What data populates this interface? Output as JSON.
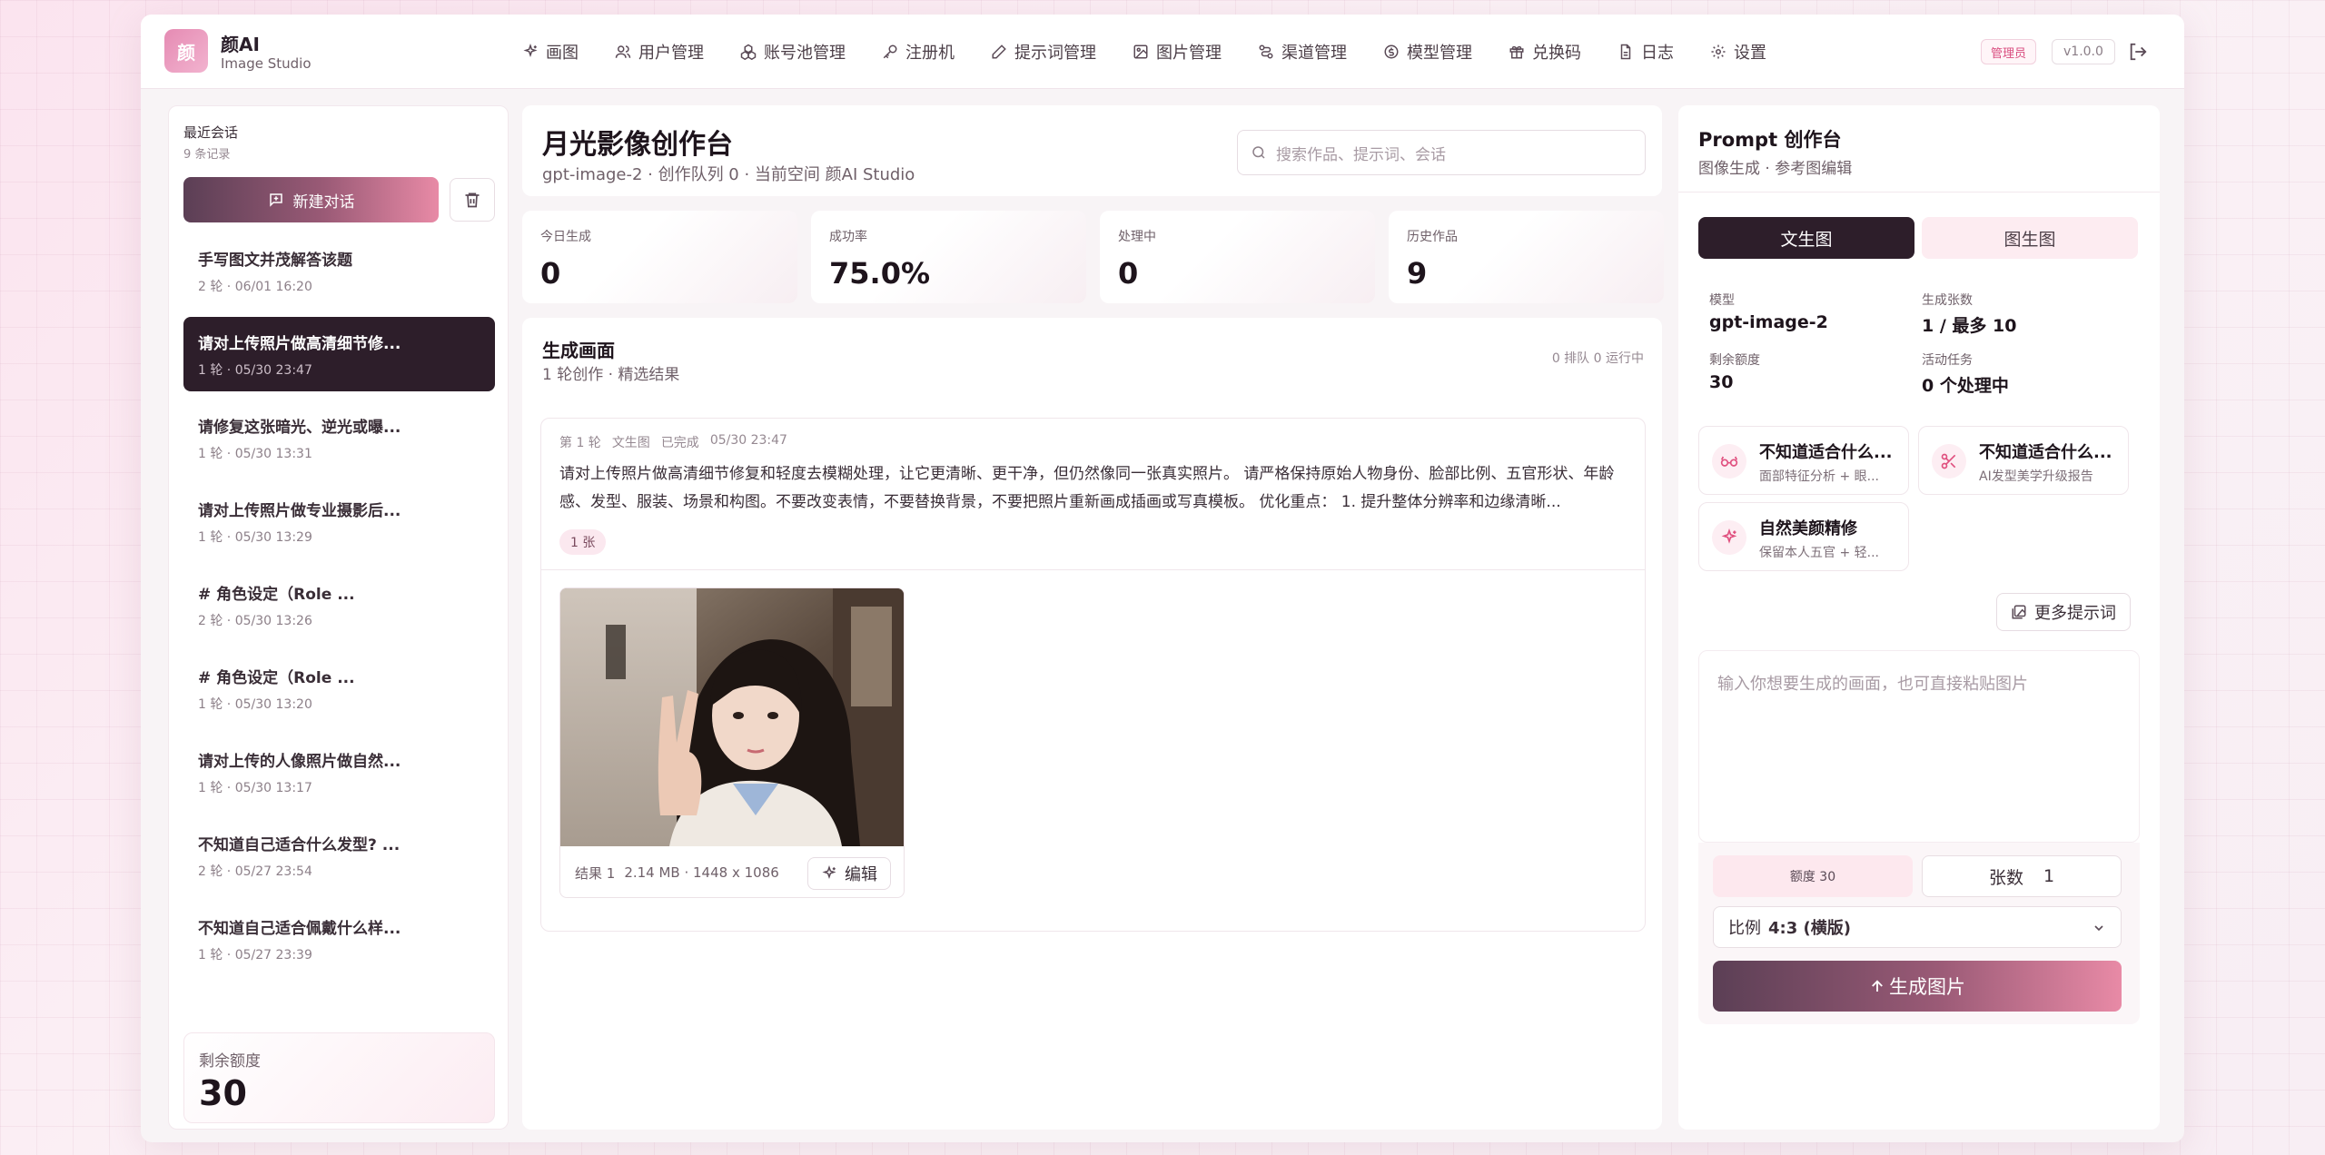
{
  "brand": {
    "logo_char": "颜",
    "name": "颜AI",
    "sub": "Image Studio"
  },
  "nav": [
    {
      "label": "画图",
      "icon": "sparkle-icon"
    },
    {
      "label": "用户管理",
      "icon": "users-icon"
    },
    {
      "label": "账号池管理",
      "icon": "boxes-icon"
    },
    {
      "label": "注册机",
      "icon": "key-icon"
    },
    {
      "label": "提示词管理",
      "icon": "pencil-icon"
    },
    {
      "label": "图片管理",
      "icon": "image-icon"
    },
    {
      "label": "渠道管理",
      "icon": "route-icon"
    },
    {
      "label": "模型管理",
      "icon": "coin-icon"
    },
    {
      "label": "兑换码",
      "icon": "gift-icon"
    },
    {
      "label": "日志",
      "icon": "file-icon"
    },
    {
      "label": "设置",
      "icon": "gear-icon"
    }
  ],
  "header": {
    "role_badge": "管理员",
    "version": "v1.0.0"
  },
  "sidebar": {
    "title": "最近会话",
    "count": "9 条记录",
    "new_chat": "新建对话",
    "conversations": [
      {
        "title": "手写图文并茂解答该题",
        "meta": "2 轮 · 06/01 16:20"
      },
      {
        "title": "请对上传照片做高清细节修...",
        "meta": "1 轮 · 05/30 23:47"
      },
      {
        "title": "请修复这张暗光、逆光或曝...",
        "meta": "1 轮 · 05/30 13:31"
      },
      {
        "title": "请对上传照片做专业摄影后...",
        "meta": "1 轮 · 05/30 13:29"
      },
      {
        "title": "# 角色设定（Role ...",
        "meta": "2 轮 · 05/30 13:26"
      },
      {
        "title": "# 角色设定（Role ...",
        "meta": "1 轮 · 05/30 13:20"
      },
      {
        "title": "请对上传的人像照片做自然...",
        "meta": "1 轮 · 05/30 13:17"
      },
      {
        "title": "不知道自己适合什么发型? ...",
        "meta": "2 轮 · 05/27 23:54"
      },
      {
        "title": "不知道自己适合佩戴什么样...",
        "meta": "1 轮 · 05/27 23:39"
      }
    ],
    "active_index": 1,
    "quota_label": "剩余额度",
    "quota_value": "30"
  },
  "main": {
    "title": "月光影像创作台",
    "subtitle": "gpt-image-2 · 创作队列 0 · 当前空间 颜AI Studio",
    "search_placeholder": "搜索作品、提示词、会话",
    "stats": [
      {
        "label": "今日生成",
        "value": "0"
      },
      {
        "label": "成功率",
        "value": "75.0%"
      },
      {
        "label": "处理中",
        "value": "0"
      },
      {
        "label": "历史作品",
        "value": "9"
      }
    ],
    "panel_title": "生成画面",
    "panel_sub": "1 轮创作 · 精选结果",
    "panel_status": "0 排队  0 运行中",
    "task": {
      "round": "第 1 轮",
      "type": "文生图",
      "status": "已完成",
      "time": "05/30 23:47",
      "prompt": "请对上传照片做高清细节修复和轻度去模糊处理，让它更清晰、更干净，但仍然像同一张真实照片。 请严格保持原始人物身份、脸部比例、五官形状、年龄感、发型、服装、场景和构图。不要改变表情，不要替换背景，不要把照片重新画成插画或写真模板。 优化重点： 1. 提升整体分辨率和边缘清晰...",
      "count_chip": "1 张",
      "result_label": "结果 1",
      "result_meta": "2.14 MB · 1448 x 1086",
      "edit_label": "编辑"
    }
  },
  "right": {
    "title": "Prompt 创作台",
    "subtitle": "图像生成 · 参考图编辑",
    "tab_text2img": "文生图",
    "tab_img2img": "图生图",
    "model_label": "模型",
    "model_value": "gpt-image-2",
    "count_label": "生成张数",
    "count_value": "1 / 最多 10",
    "quota_label": "剩余额度",
    "quota_value": "30",
    "tasks_label": "活动任务",
    "tasks_value": "0 个处理中",
    "templates": [
      {
        "title": "不知道适合什么...",
        "desc": "面部特征分析 + 眼...",
        "icon": "glasses-icon"
      },
      {
        "title": "不知道适合什么...",
        "desc": "AI发型美学升级报告",
        "icon": "scissors-icon"
      },
      {
        "title": "自然美颜精修",
        "desc": "保留本人五官 + 轻...",
        "icon": "sparkle-icon"
      }
    ],
    "more_prompts": "更多提示词",
    "prompt_placeholder": "输入你想要生成的画面，也可直接粘贴图片",
    "quota_pill": "额度 30",
    "count_box_label": "张数",
    "count_box_value": "1",
    "ratio_label": "比例",
    "ratio_value": "4:3 (横版)",
    "generate": "生成图片"
  },
  "colors": {
    "accent": "#e88aa6",
    "dark": "#2d1e2a",
    "brand_pink": "#e58bb3"
  }
}
